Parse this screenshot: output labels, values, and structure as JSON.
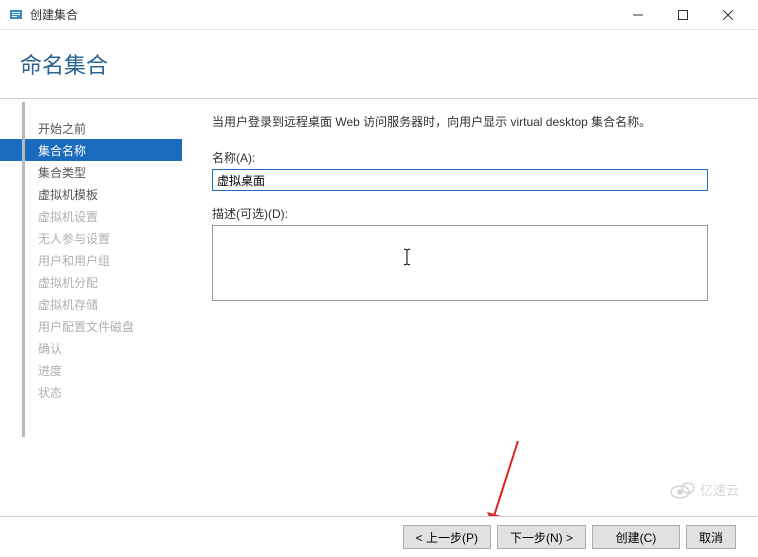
{
  "window": {
    "title": "创建集合"
  },
  "header": {
    "title": "命名集合"
  },
  "sidebar": {
    "items": [
      {
        "label": "开始之前",
        "state": "normal"
      },
      {
        "label": "集合名称",
        "state": "active"
      },
      {
        "label": "集合类型",
        "state": "normal"
      },
      {
        "label": "虚拟机模板",
        "state": "normal"
      },
      {
        "label": "虚拟机设置",
        "state": "disabled"
      },
      {
        "label": "无人参与设置",
        "state": "disabled"
      },
      {
        "label": "用户和用户组",
        "state": "disabled"
      },
      {
        "label": "虚拟机分配",
        "state": "disabled"
      },
      {
        "label": "虚拟机存储",
        "state": "disabled"
      },
      {
        "label": "用户配置文件磁盘",
        "state": "disabled"
      },
      {
        "label": "确认",
        "state": "disabled"
      },
      {
        "label": "进度",
        "state": "disabled"
      },
      {
        "label": "状态",
        "state": "disabled"
      }
    ]
  },
  "main": {
    "instruction": "当用户登录到远程桌面 Web 访问服务器时，向用户显示 virtual desktop 集合名称。",
    "name_label": "名称(A):",
    "name_value": "虚拟桌面",
    "desc_label": "描述(可选)(D):",
    "desc_value": ""
  },
  "footer": {
    "prev": "< 上一步(P)",
    "next": "下一步(N) >",
    "create": "创建(C)",
    "cancel": "取消"
  },
  "watermark": {
    "text": "亿速云"
  }
}
